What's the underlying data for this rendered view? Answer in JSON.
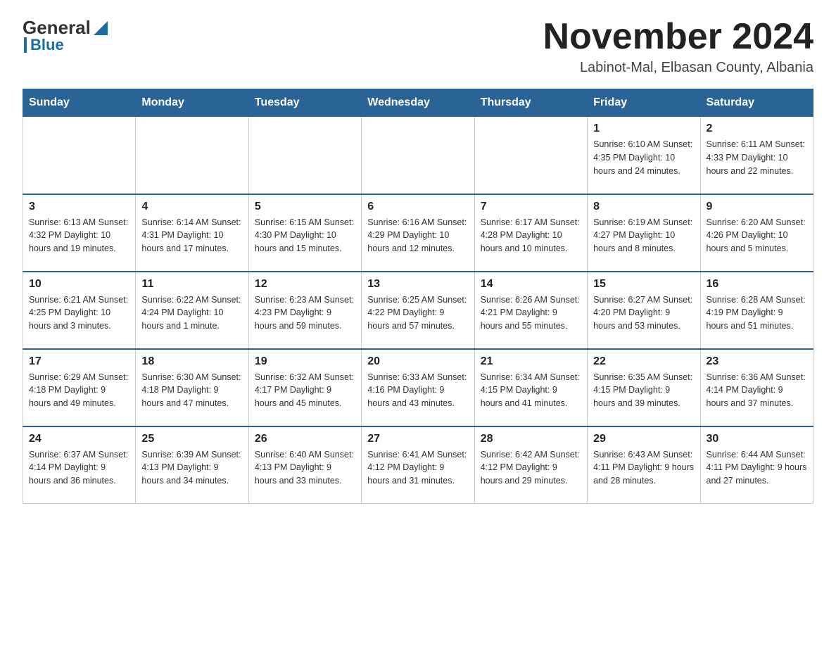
{
  "header": {
    "logo_general": "General",
    "logo_blue": "Blue",
    "month_title": "November 2024",
    "location": "Labinot-Mal, Elbasan County, Albania"
  },
  "weekdays": [
    "Sunday",
    "Monday",
    "Tuesday",
    "Wednesday",
    "Thursday",
    "Friday",
    "Saturday"
  ],
  "weeks": [
    [
      {
        "day": "",
        "info": ""
      },
      {
        "day": "",
        "info": ""
      },
      {
        "day": "",
        "info": ""
      },
      {
        "day": "",
        "info": ""
      },
      {
        "day": "",
        "info": ""
      },
      {
        "day": "1",
        "info": "Sunrise: 6:10 AM\nSunset: 4:35 PM\nDaylight: 10 hours and 24 minutes."
      },
      {
        "day": "2",
        "info": "Sunrise: 6:11 AM\nSunset: 4:33 PM\nDaylight: 10 hours and 22 minutes."
      }
    ],
    [
      {
        "day": "3",
        "info": "Sunrise: 6:13 AM\nSunset: 4:32 PM\nDaylight: 10 hours and 19 minutes."
      },
      {
        "day": "4",
        "info": "Sunrise: 6:14 AM\nSunset: 4:31 PM\nDaylight: 10 hours and 17 minutes."
      },
      {
        "day": "5",
        "info": "Sunrise: 6:15 AM\nSunset: 4:30 PM\nDaylight: 10 hours and 15 minutes."
      },
      {
        "day": "6",
        "info": "Sunrise: 6:16 AM\nSunset: 4:29 PM\nDaylight: 10 hours and 12 minutes."
      },
      {
        "day": "7",
        "info": "Sunrise: 6:17 AM\nSunset: 4:28 PM\nDaylight: 10 hours and 10 minutes."
      },
      {
        "day": "8",
        "info": "Sunrise: 6:19 AM\nSunset: 4:27 PM\nDaylight: 10 hours and 8 minutes."
      },
      {
        "day": "9",
        "info": "Sunrise: 6:20 AM\nSunset: 4:26 PM\nDaylight: 10 hours and 5 minutes."
      }
    ],
    [
      {
        "day": "10",
        "info": "Sunrise: 6:21 AM\nSunset: 4:25 PM\nDaylight: 10 hours and 3 minutes."
      },
      {
        "day": "11",
        "info": "Sunrise: 6:22 AM\nSunset: 4:24 PM\nDaylight: 10 hours and 1 minute."
      },
      {
        "day": "12",
        "info": "Sunrise: 6:23 AM\nSunset: 4:23 PM\nDaylight: 9 hours and 59 minutes."
      },
      {
        "day": "13",
        "info": "Sunrise: 6:25 AM\nSunset: 4:22 PM\nDaylight: 9 hours and 57 minutes."
      },
      {
        "day": "14",
        "info": "Sunrise: 6:26 AM\nSunset: 4:21 PM\nDaylight: 9 hours and 55 minutes."
      },
      {
        "day": "15",
        "info": "Sunrise: 6:27 AM\nSunset: 4:20 PM\nDaylight: 9 hours and 53 minutes."
      },
      {
        "day": "16",
        "info": "Sunrise: 6:28 AM\nSunset: 4:19 PM\nDaylight: 9 hours and 51 minutes."
      }
    ],
    [
      {
        "day": "17",
        "info": "Sunrise: 6:29 AM\nSunset: 4:18 PM\nDaylight: 9 hours and 49 minutes."
      },
      {
        "day": "18",
        "info": "Sunrise: 6:30 AM\nSunset: 4:18 PM\nDaylight: 9 hours and 47 minutes."
      },
      {
        "day": "19",
        "info": "Sunrise: 6:32 AM\nSunset: 4:17 PM\nDaylight: 9 hours and 45 minutes."
      },
      {
        "day": "20",
        "info": "Sunrise: 6:33 AM\nSunset: 4:16 PM\nDaylight: 9 hours and 43 minutes."
      },
      {
        "day": "21",
        "info": "Sunrise: 6:34 AM\nSunset: 4:15 PM\nDaylight: 9 hours and 41 minutes."
      },
      {
        "day": "22",
        "info": "Sunrise: 6:35 AM\nSunset: 4:15 PM\nDaylight: 9 hours and 39 minutes."
      },
      {
        "day": "23",
        "info": "Sunrise: 6:36 AM\nSunset: 4:14 PM\nDaylight: 9 hours and 37 minutes."
      }
    ],
    [
      {
        "day": "24",
        "info": "Sunrise: 6:37 AM\nSunset: 4:14 PM\nDaylight: 9 hours and 36 minutes."
      },
      {
        "day": "25",
        "info": "Sunrise: 6:39 AM\nSunset: 4:13 PM\nDaylight: 9 hours and 34 minutes."
      },
      {
        "day": "26",
        "info": "Sunrise: 6:40 AM\nSunset: 4:13 PM\nDaylight: 9 hours and 33 minutes."
      },
      {
        "day": "27",
        "info": "Sunrise: 6:41 AM\nSunset: 4:12 PM\nDaylight: 9 hours and 31 minutes."
      },
      {
        "day": "28",
        "info": "Sunrise: 6:42 AM\nSunset: 4:12 PM\nDaylight: 9 hours and 29 minutes."
      },
      {
        "day": "29",
        "info": "Sunrise: 6:43 AM\nSunset: 4:11 PM\nDaylight: 9 hours and 28 minutes."
      },
      {
        "day": "30",
        "info": "Sunrise: 6:44 AM\nSunset: 4:11 PM\nDaylight: 9 hours and 27 minutes."
      }
    ]
  ]
}
